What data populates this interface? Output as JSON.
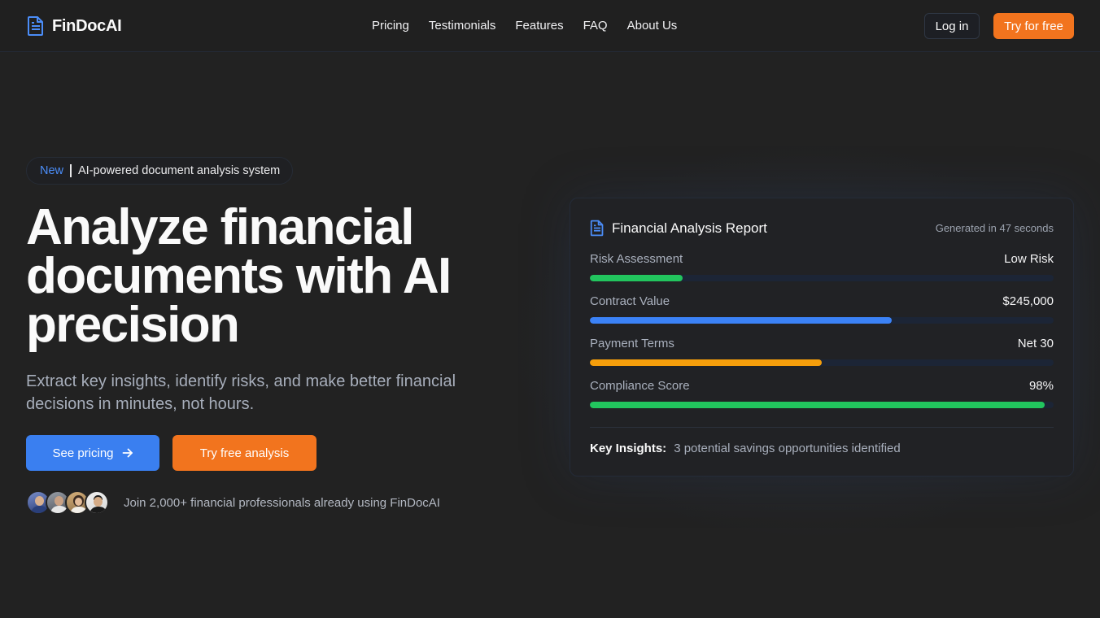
{
  "nav": {
    "brand": "FinDocAI",
    "links": [
      "Pricing",
      "Testimonials",
      "Features",
      "FAQ",
      "About Us"
    ],
    "login": "Log in",
    "try": "Try for free"
  },
  "hero": {
    "badge_new": "New",
    "badge_text": "AI-powered document analysis system",
    "title_line1": "Analyze financial",
    "title_line2": "documents with AI",
    "title_line3": "precision",
    "subtitle": "Extract key insights, identify risks, and make better financial decisions in minutes, not hours.",
    "pricing_button": "See pricing",
    "free_button": "Try free analysis",
    "social_proof": "Join 2,000+ financial professionals already using FinDocAI"
  },
  "report": {
    "title": "Financial Analysis Report",
    "generated": "Generated in 47 seconds",
    "metrics": [
      {
        "label": "Risk Assessment",
        "value": "Low Risk",
        "fill": 0.2,
        "color": "#22c55e"
      },
      {
        "label": "Contract Value",
        "value": "$245,000",
        "fill": 0.65,
        "color": "#3b82f6"
      },
      {
        "label": "Payment Terms",
        "value": "Net 30",
        "fill": 0.5,
        "color": "#f59e0b"
      },
      {
        "label": "Compliance Score",
        "value": "98%",
        "fill": 0.98,
        "color": "#22c55e"
      }
    ],
    "insights_label": "Key Insights:",
    "insights_text": "3 potential savings opportunities identified"
  },
  "colors": {
    "accent_blue": "#3a7ff0",
    "accent_orange": "#f2741e",
    "background": "#222222"
  }
}
